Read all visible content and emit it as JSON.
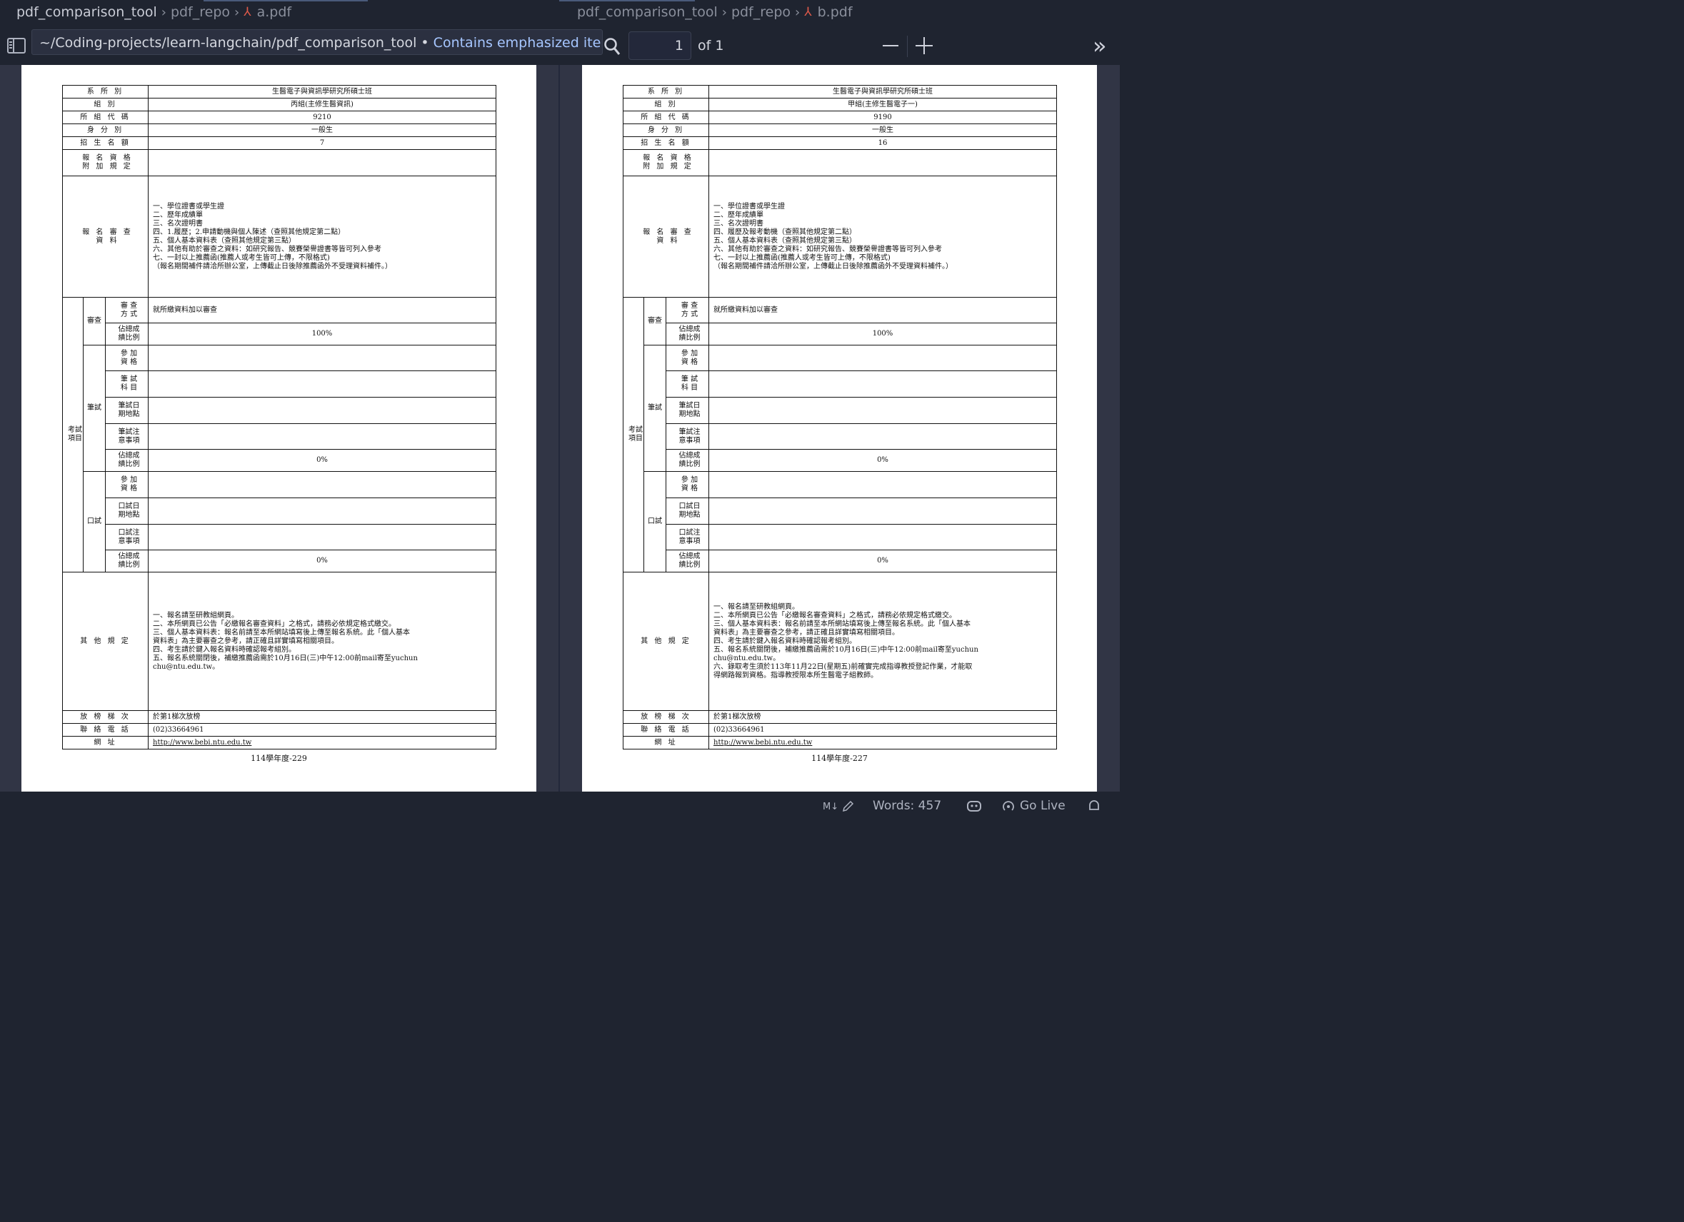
{
  "left_tab": {
    "breadcrumb_1": "pdf_comparison_tool",
    "breadcrumb_2": "pdf_repo",
    "file": "a.pdf"
  },
  "right_tab": {
    "breadcrumb_1": "pdf_comparison_tool",
    "breadcrumb_2": "pdf_repo",
    "file": "b.pdf"
  },
  "tooltip": {
    "path": "~/Coding-projects/learn-langchain/pdf_comparison_tool",
    "separator": "•",
    "note": "Contains emphasized items"
  },
  "toolbar": {
    "page_value": "1",
    "page_total": "of 1",
    "more": "»"
  },
  "form_labels": {
    "dept": "系 所 別",
    "group": "組 別",
    "code": "所 組 代 碼",
    "identity": "身 分 別",
    "quota": "招 生 名 額",
    "eligibility": "報 名 資 格\n附 加 規 定",
    "materials": "報 名 審 查\n資 料",
    "exam_items": "考試\n項目",
    "review": "審查",
    "written": "筆試",
    "oral": "口試",
    "review_method": "審 查\n方 式",
    "weight": "佔總成\n績比例",
    "participate": "參 加\n資 格",
    "written_subjects": "筆 試\n科 目",
    "written_datetime": "筆試日\n期地點",
    "written_notes": "筆試注\n意事項",
    "oral_datetime": "口試日\n期地點",
    "oral_notes": "口試注\n意事項",
    "other": "其 他 規 定",
    "release": "放 榜 梯 次",
    "phone": "聯 絡 電 話",
    "website": "網 址"
  },
  "doc_a": {
    "dept": "生醫電子與資訊學研究所碩士班",
    "group": "丙組(主修生醫資訊)",
    "code": "9210",
    "identity": "一般生",
    "quota": "7",
    "materials": "一、學位證書或學生證\n二、歷年成績單\n三、名次證明書\n四、1.履歷；2.申請動機與個人陳述（查照其他規定第二點）\n五、個人基本資料表（查照其他規定第三點）\n六、其他有助於審查之資料：如研究報告、競賽榮譽證書等皆可列入參考\n七、一封以上推薦函(推薦人或考生皆可上傳，不限格式)\n（報名期間補件請洽所辦公室，上傳截止日後除推薦函外不受理資料補件。）",
    "review_method": "就所繳資料加以審查",
    "review_weight": "100%",
    "written_weight": "0%",
    "oral_weight": "0%",
    "other": "一、報名請至研教組網頁。\n二、本所網頁已公告「必繳報名審查資料」之格式，請務必依規定格式繳交。\n三、個人基本資料表：報名前請至本所網站填寫後上傳至報名系統。此「個人基本\n     資料表」為主要審查之參考，請正確且詳實填寫相關項目。\n四、考生請於鍵入報名資料時確認報考組別。\n五、報名系統關閉後，補繳推薦函需於10月16日(三)中午12:00前mail寄至yuchun\n     chu@ntu.edu.tw。",
    "release": "於第1梯次放榜",
    "phone": "(02)33664961",
    "website": "http://www.bebi.ntu.edu.tw",
    "footer": "114學年度-229"
  },
  "doc_b": {
    "dept": "生醫電子與資訊學研究所碩士班",
    "group": "甲組(主修生醫電子一)",
    "code": "9190",
    "identity": "一般生",
    "quota": "16",
    "materials": "一、學位證書或學生證\n二、歷年成績單\n三、名次證明書\n四、履歷及報考動機（查照其他規定第二點）\n五、個人基本資料表（查照其他規定第三點）\n六、其他有助於審查之資料：如研究報告、競賽榮譽證書等皆可列入參考\n七、一封以上推薦函(推薦人或考生皆可上傳，不限格式)\n（報名期間補件請洽所辦公室，上傳截止日後除推薦函外不受理資料補件。）",
    "review_method": "就所繳資料加以審查",
    "review_weight": "100%",
    "written_weight": "0%",
    "oral_weight": "0%",
    "other": "一、報名請至研教組網頁。\n二、本所網頁已公告「必繳報名審查資料」之格式，請務必依規定格式繳交。\n三、個人基本資料表：報名前請至本所網站填寫後上傳至報名系統。此「個人基本\n     資料表」為主要審查之參考，請正確且詳實填寫相關項目。\n四、考生請於鍵入報名資料時確認報考組別。\n五、報名系統關閉後，補繳推薦函需於10月16日(三)中午12:00前mail寄至yuchun\n     chu@ntu.edu.tw。\n六、錄取考生須於113年11月22日(星期五)前確實完成指導教授登記作業，才能取\n     得網路報到資格。指導教授限本所生醫電子組教師。",
    "release": "於第1梯次放榜",
    "phone": "(02)33664961",
    "website": "http://www.bebi.ntu.edu.tw",
    "footer": "114學年度-227"
  },
  "statusbar": {
    "markdown": "M↓",
    "words": "Words: 457",
    "go_live": "Go Live"
  }
}
